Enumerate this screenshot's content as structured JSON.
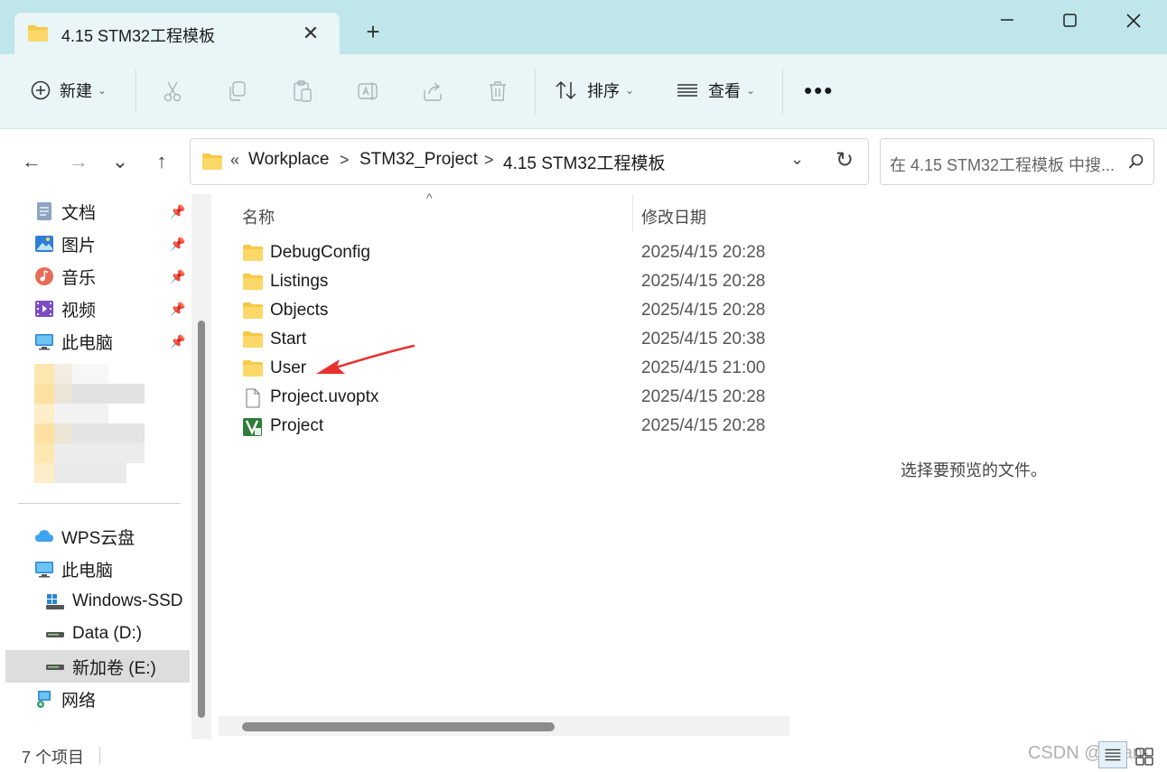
{
  "window": {
    "tab_title": "4.15 STM32工程模板",
    "close_tab": "✕",
    "new_tab": "+"
  },
  "toolbar": {
    "new_label": "新建",
    "sort_label": "排序",
    "view_label": "查看",
    "more_label": "•••",
    "chevron": "⌄"
  },
  "nav": {
    "back": "←",
    "forward": "→",
    "recent": "⌄",
    "up": "↑"
  },
  "address": {
    "overflow": "«",
    "separator": ">",
    "crumbs": [
      "Workplace",
      "STM32_Project",
      "4.15 STM32工程模板"
    ],
    "dropdown": "⌄",
    "refresh": "↻"
  },
  "search": {
    "placeholder": "在 4.15 STM32工程模板 中搜..."
  },
  "sidebar": {
    "quick_access": [
      {
        "label": "文档",
        "icon": "documents-icon"
      },
      {
        "label": "图片",
        "icon": "pictures-icon"
      },
      {
        "label": "音乐",
        "icon": "music-icon"
      },
      {
        "label": "视频",
        "icon": "videos-icon"
      },
      {
        "label": "此电脑",
        "icon": "this-pc-icon"
      }
    ],
    "pin": "📌",
    "tree": [
      {
        "label": "WPS云盘",
        "icon": "cloud-icon"
      },
      {
        "label": "此电脑",
        "icon": "this-pc-icon"
      },
      {
        "label": "Windows-SSD",
        "icon": "windows-drive-icon"
      },
      {
        "label": "Data (D:)",
        "icon": "drive-icon"
      },
      {
        "label": "新加卷 (E:)",
        "icon": "drive-icon",
        "selected": true
      },
      {
        "label": "网络",
        "icon": "network-icon"
      }
    ]
  },
  "filelist": {
    "columns": {
      "name": "名称",
      "date": "修改日期"
    },
    "sort_indicator": "^",
    "files": [
      {
        "name": "DebugConfig",
        "date": "2025/4/15 20:28",
        "type": "folder"
      },
      {
        "name": "Listings",
        "date": "2025/4/15 20:28",
        "type": "folder"
      },
      {
        "name": "Objects",
        "date": "2025/4/15 20:28",
        "type": "folder"
      },
      {
        "name": "Start",
        "date": "2025/4/15 20:38",
        "type": "folder"
      },
      {
        "name": "User",
        "date": "2025/4/15 21:00",
        "type": "folder"
      },
      {
        "name": "Project.uvoptx",
        "date": "2025/4/15 20:28",
        "type": "file"
      },
      {
        "name": "Project",
        "date": "2025/4/15 20:28",
        "type": "keil-project"
      }
    ]
  },
  "preview": {
    "empty_text": "选择要预览的文件。"
  },
  "status": {
    "item_count": "7 个项目",
    "watermark": "CSDN @eean-"
  },
  "colors": {
    "titlebar": "#bfe6ea",
    "toolbar": "#e9f5f7",
    "folder": "#f6c945",
    "arrow": "#e8312f"
  }
}
